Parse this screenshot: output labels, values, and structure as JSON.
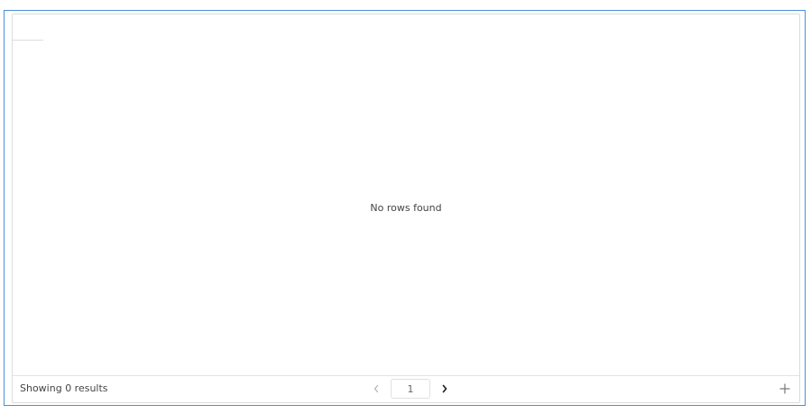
{
  "grid": {
    "empty_message": "No rows found"
  },
  "footer": {
    "results_text": "Showing 0 results",
    "current_page": "1",
    "icons": {
      "prev": "chevron-left-icon",
      "next": "chevron-right-icon",
      "add": "plus-icon"
    }
  },
  "colors": {
    "focus_border": "#4a90d9",
    "panel_border": "#dcdcdc",
    "text": "#444444"
  }
}
